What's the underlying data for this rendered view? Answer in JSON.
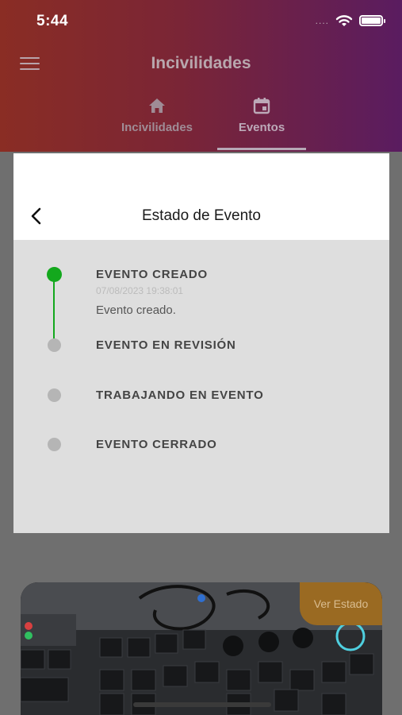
{
  "status_bar": {
    "time": "5:44",
    "signal": "....",
    "wifi_icon": "wifi-icon",
    "battery_icon": "battery-icon"
  },
  "app_bar": {
    "menu_icon": "menu-icon",
    "title": "Incivilidades"
  },
  "tabs": [
    {
      "label": "Incivilidades",
      "icon": "home-icon",
      "selected": false
    },
    {
      "label": "Eventos",
      "icon": "calendar-icon",
      "selected": true
    }
  ],
  "modal": {
    "back_icon": "chevron-left-icon",
    "title": "Estado de Evento",
    "steps": [
      {
        "title": "EVENTO CREADO",
        "date": "07/08/2023 19:38:01",
        "description": "Evento creado.",
        "completed": true
      },
      {
        "title": "EVENTO EN REVISIÓN",
        "completed": false
      },
      {
        "title": "TRABAJANDO EN EVENTO",
        "completed": false
      },
      {
        "title": "EVENTO CERRADO",
        "completed": false
      }
    ],
    "colors": {
      "active": "#13a81d",
      "inactive": "#b5b5b5"
    }
  },
  "card": {
    "button_label": "Ver Estado"
  }
}
